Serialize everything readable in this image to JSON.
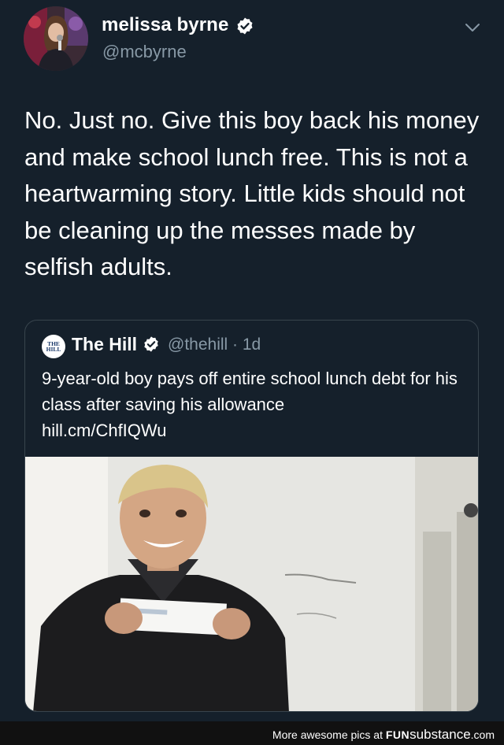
{
  "tweet": {
    "author": {
      "display_name": "melissa byrne",
      "handle": "@mcbyrne",
      "verified": true
    },
    "text": "No. Just no. Give this boy back his money and make school lunch free. This is not a heartwarming story. Little kids should not be cleaning up the messes made by selfish adults."
  },
  "quoted_tweet": {
    "logo_text_top": "THE",
    "logo_text_bottom": "HILL",
    "display_name": "The Hill",
    "verified": true,
    "handle_time": "@thehill · 1d",
    "text": "9-year-old boy pays off entire school lunch debt for his class after saving his allowance",
    "link": "hill.cm/ChfIQWu"
  },
  "footer": {
    "prefix": "More awesome pics at ",
    "brand_a": "FUN",
    "brand_b": "substance",
    "suffix": ".com"
  },
  "colors": {
    "background": "#15202b",
    "border": "#38444d",
    "secondary_text": "#8899a6",
    "verified": "#ffffff"
  },
  "icons": [
    "verified-badge-icon",
    "chevron-down-icon"
  ]
}
